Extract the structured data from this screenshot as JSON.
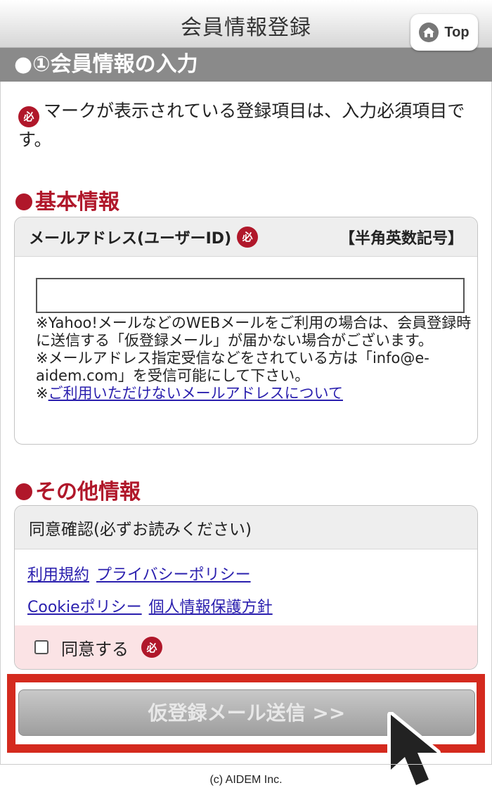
{
  "header": {
    "title": "会員情報登録",
    "top_label": "Top"
  },
  "section": {
    "title": "●①会員情報の入力"
  },
  "notice": {
    "must_mark": "必",
    "text": "マークが表示されている登録項目は、入力必須項目です。"
  },
  "basic": {
    "title": "基本情報",
    "email_label": "メールアドレス(ユーザーID)",
    "format_hint": "【半角英数記号】",
    "email_value": "",
    "note_line1": "※Yahoo!メールなどのWEBメールをご利用の場合は、会員登録時に送信する「仮登録メール」が届かない場合がございます。",
    "note_line2": "※メールアドレス指定受信などをされている方は「info@e-aidem.com」を受信可能にして下さい。",
    "note_prefix": "※",
    "note_link": "ご利用いただけないメールアドレスについて"
  },
  "other": {
    "title": "その他情報",
    "consent_header": "同意確認(必ずお読みください)",
    "links_row1": [
      "利用規約",
      "プライバシーポリシー"
    ],
    "links_row2": [
      "Cookieポリシー",
      "個人情報保護方針"
    ],
    "agree_label": "同意する"
  },
  "submit": {
    "label": "仮登録メール送信 >>"
  },
  "footer": {
    "copyright": "(c) AIDEM Inc."
  },
  "colors": {
    "accent": "#b0172a",
    "link": "#2a1fae",
    "highlight": "#d42a1e"
  }
}
